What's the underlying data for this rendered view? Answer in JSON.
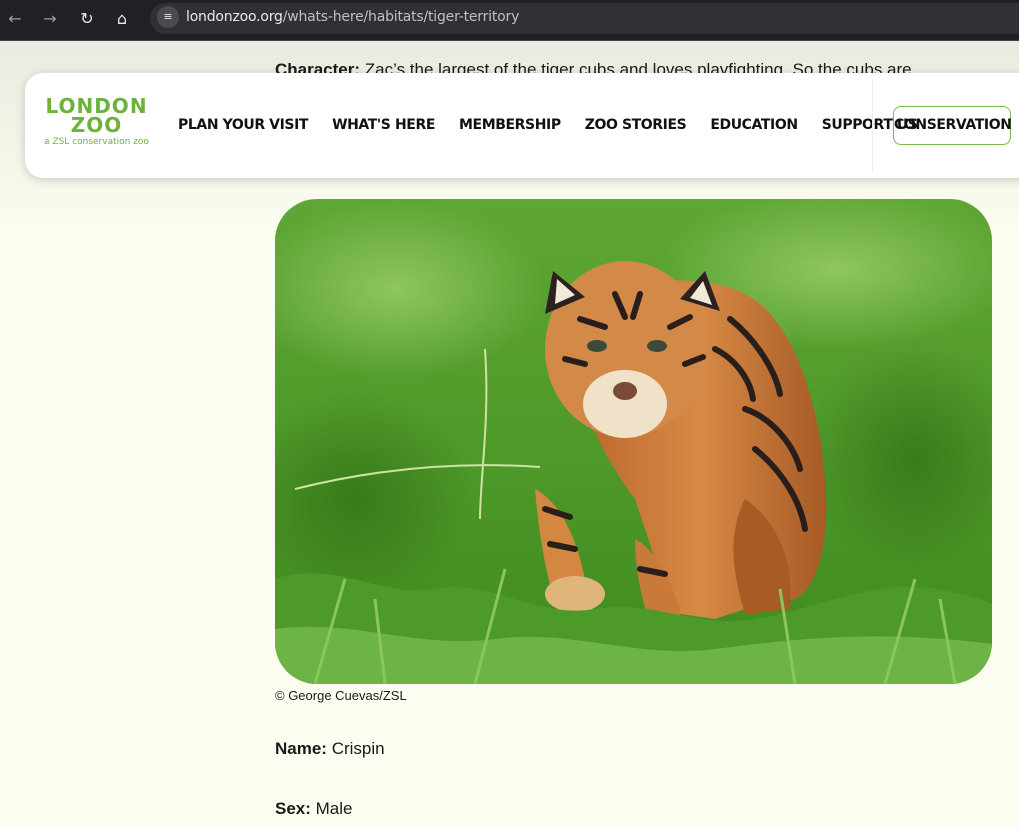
{
  "browser": {
    "url_domain": "londonzoo.org",
    "url_path": "/whats-here/habitats/tiger-territory",
    "icons": [
      "back-arrow-icon",
      "forward-arrow-icon",
      "reload-icon",
      "home-icon",
      "site-settings-icon"
    ]
  },
  "intro": {
    "label": "Character:",
    "text": " Zac’s the largest of the tiger cubs and loves playfighting. So the cubs are"
  },
  "header": {
    "logo": {
      "line1": "LONDON",
      "line2": "ZOO",
      "tagline": "a ZSL conservation zoo"
    },
    "menu": [
      "PLAN YOUR VISIT",
      "WHAT'S HERE",
      "MEMBERSHIP",
      "ZOO STORIES",
      "EDUCATION",
      "SUPPORT US"
    ],
    "cta": "CONSERVATION"
  },
  "photo": {
    "credit": "© George Cuevas/ZSL"
  },
  "facts": [
    {
      "label": "Name:",
      "value": " Crispin"
    },
    {
      "label": "Sex:",
      "value": " Male"
    }
  ],
  "colors": {
    "brand_green": "#6bb33a",
    "page_bg": "#fbfdf0",
    "chrome_bg": "#202124"
  }
}
